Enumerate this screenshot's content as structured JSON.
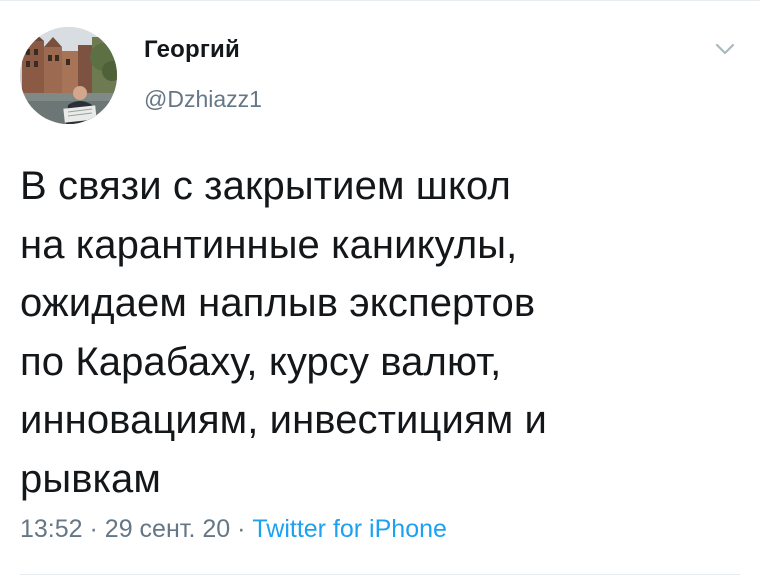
{
  "author": {
    "display_name": "Георгий",
    "handle": "@Dzhiazz1"
  },
  "tweet": {
    "text": "В связи с закрытием школ\nна карантинные каникулы,\nожидаем наплыв экспертов\nпо Карабаху, курсу валют,\nинновациям, инвестициям и\nрывкам",
    "time": "13:52",
    "separator": "·",
    "date": "29 сент. 20",
    "source": "Twitter for iPhone"
  },
  "icons": {
    "more": "chevron-down-icon",
    "avatar": "profile-photo"
  },
  "colors": {
    "text": "#14171a",
    "secondary": "#657786",
    "link": "#1da1f2",
    "divider": "#e6ecf0"
  }
}
